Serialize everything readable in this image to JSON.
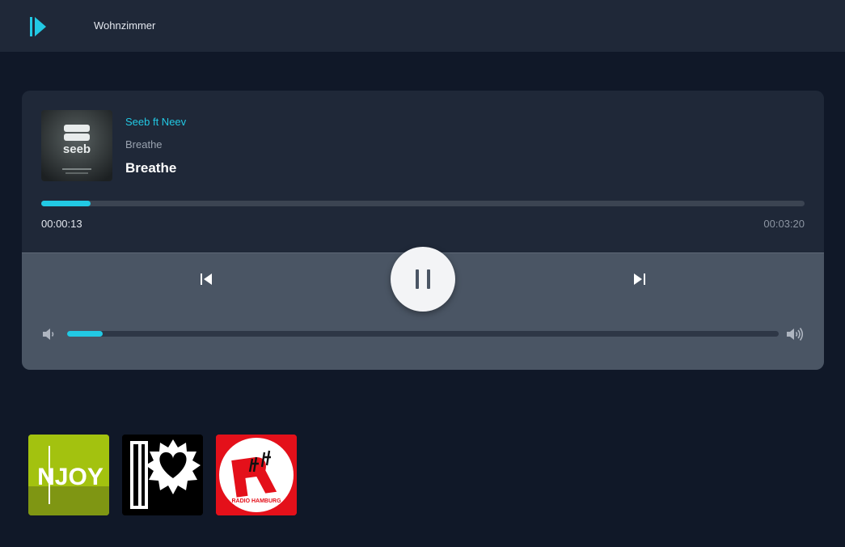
{
  "header": {
    "room": "Wohnzimmer",
    "logo_icon": "play-logo-icon"
  },
  "player": {
    "artist": "Seeb ft Neev",
    "album": "Breathe",
    "title": "Breathe",
    "cover_text": "seeb",
    "elapsed": "00:00:13",
    "duration": "00:03:20",
    "progress": 0.065,
    "volume": 0.05,
    "accent_color": "#22c9e4"
  },
  "stations": [
    {
      "name": "N-JOY",
      "logo_text": "NJOY"
    },
    {
      "name": "I Like",
      "logo_text": ""
    },
    {
      "name": "Radio Hamburg",
      "logo_text": "RADIO HAMBURG"
    }
  ]
}
